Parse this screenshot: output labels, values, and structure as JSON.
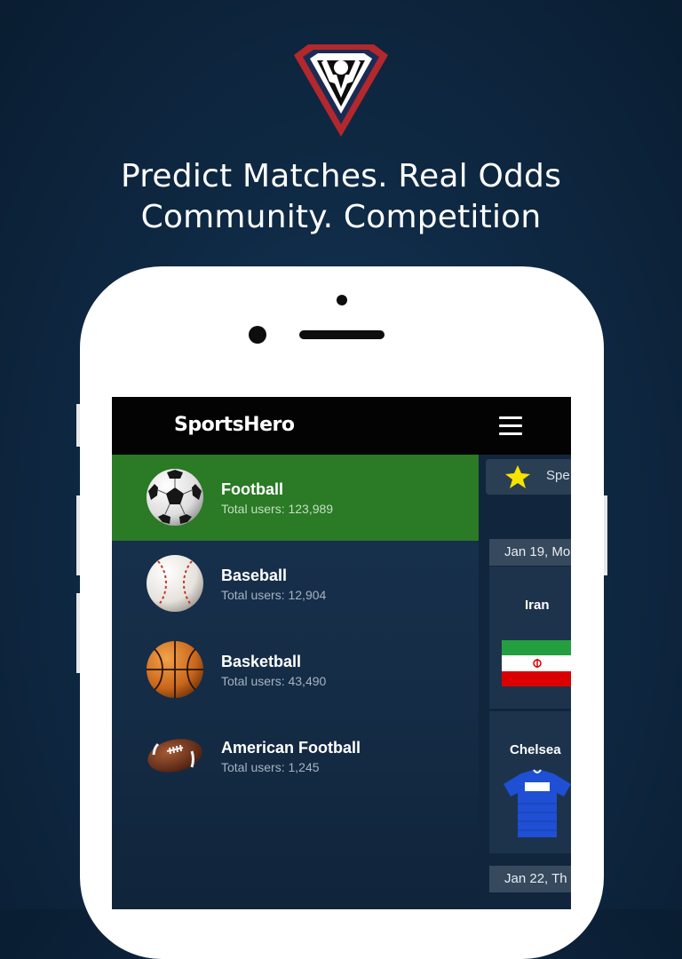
{
  "headline": {
    "line1": "Predict Matches. Real Odds",
    "line2": "Community. Competition"
  },
  "app": {
    "brand": "SportsHero",
    "menu_icon": "hamburger-menu-icon"
  },
  "sports": [
    {
      "name": "Football",
      "users": "Total users: 123,989",
      "icon": "soccer-ball-icon",
      "active": true
    },
    {
      "name": "Baseball",
      "users": "Total users: 12,904",
      "icon": "baseball-icon",
      "active": false
    },
    {
      "name": "Basketball",
      "users": "Total users: 43,490",
      "icon": "basketball-icon",
      "active": false
    },
    {
      "name": "American Football",
      "users": "Total users: 1,245",
      "icon": "american-football-icon",
      "active": false
    }
  ],
  "right_panel": {
    "special_label": "Spe",
    "dates": [
      "Jan 19, Mo",
      "Jan 22, Th"
    ],
    "teams": [
      "Iran",
      "Chelsea"
    ]
  },
  "colors": {
    "background": "#0f2a45",
    "active_row": "#2a7a26",
    "topbar": "#030303",
    "star": "#f5e400"
  }
}
